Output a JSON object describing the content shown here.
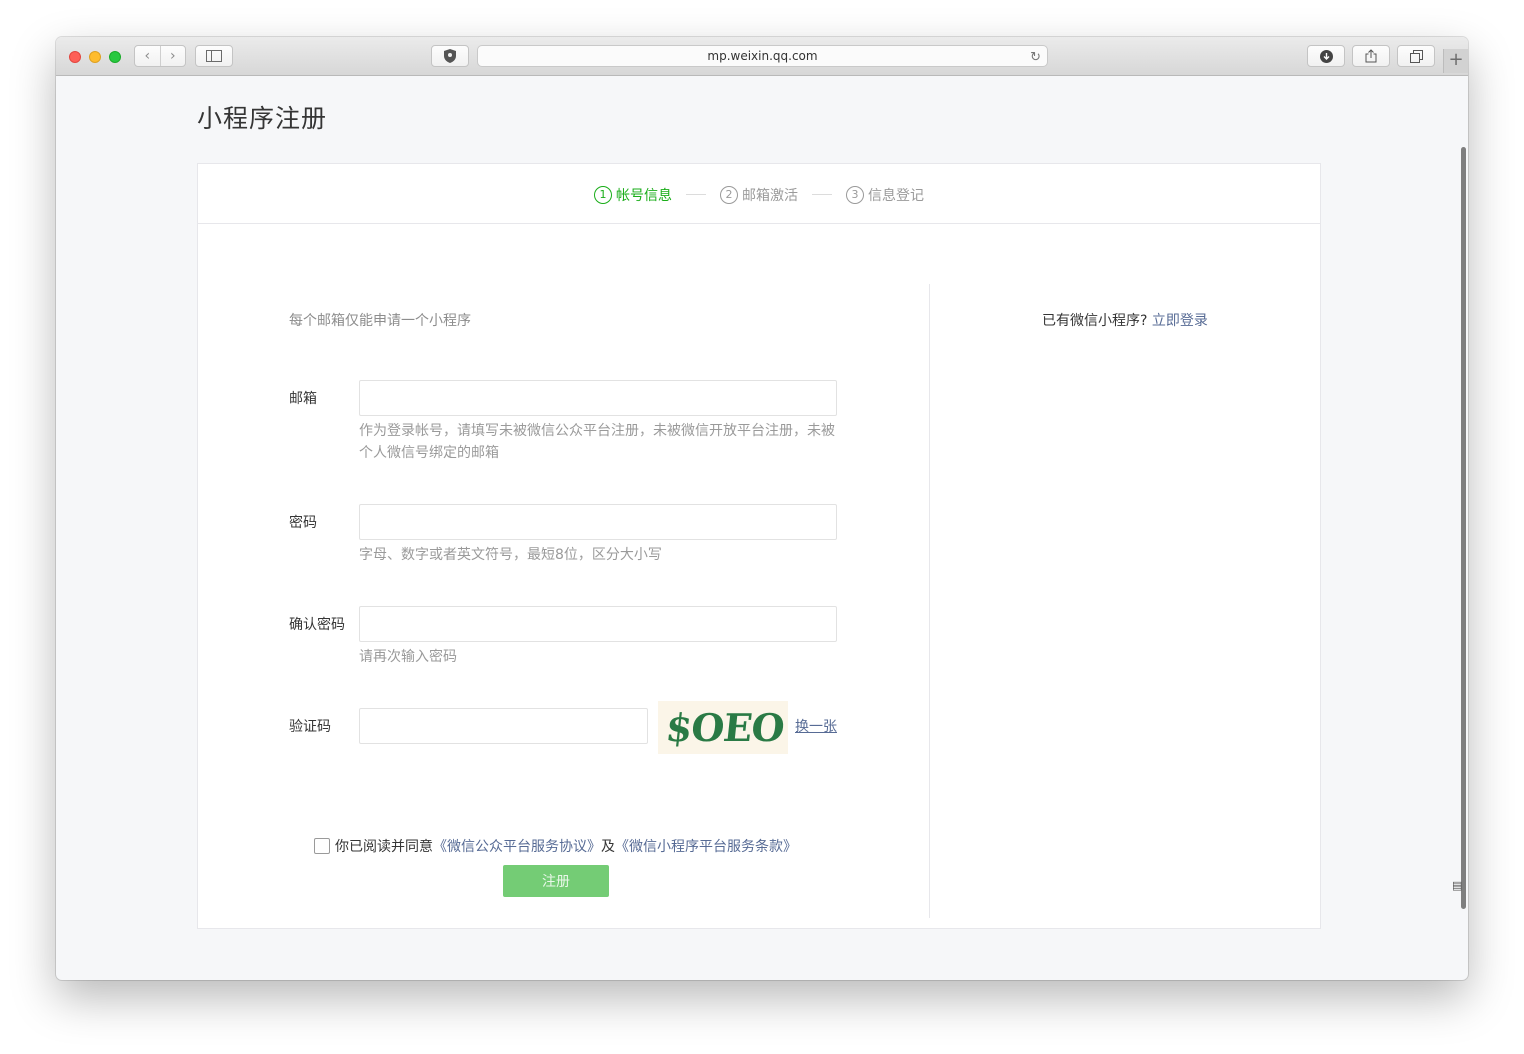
{
  "browser": {
    "url": "mp.weixin.qq.com",
    "icons": {
      "back": "chevron-left-icon",
      "forward": "chevron-right-icon",
      "sidebar": "sidebar-icon",
      "shield": "shield-icon",
      "reload": "reload-icon",
      "download": "download-icon",
      "share": "share-icon",
      "tabs": "tabs-icon",
      "new_tab": "plus-icon"
    }
  },
  "page": {
    "title": "小程序注册"
  },
  "steps": [
    {
      "number": "1",
      "label": "帐号信息",
      "active": true
    },
    {
      "number": "2",
      "label": "邮箱激活",
      "active": false
    },
    {
      "number": "3",
      "label": "信息登记",
      "active": false
    }
  ],
  "form": {
    "notice": "每个邮箱仅能申请一个小程序",
    "email": {
      "label": "邮箱",
      "value": "",
      "tip_line1": "作为登录帐号，请填写未被微信公众平台注册，未被微信开放平台注册，未被",
      "tip_line2": "个人微信号绑定的邮箱"
    },
    "password": {
      "label": "密码",
      "value": "",
      "tip": "字母、数字或者英文符号，最短8位，区分大小写"
    },
    "confirm_password": {
      "label": "确认密码",
      "value": "",
      "tip": "请再次输入密码"
    },
    "captcha": {
      "label": "验证码",
      "value": "",
      "image_text": "$OEO",
      "refresh_label": "换一张"
    },
    "agreement": {
      "checked": false,
      "prefix": "你已阅读并同意",
      "link1": "《微信公众平台服务协议》",
      "middle": "及",
      "link2": "《微信小程序平台服务条款》"
    },
    "submit_label": "注册"
  },
  "side": {
    "prompt": "已有微信小程序?",
    "login_link": "立即登录"
  },
  "colors": {
    "accent": "#1aad19",
    "link": "#576b95",
    "button_disabled": "#74cc75"
  }
}
